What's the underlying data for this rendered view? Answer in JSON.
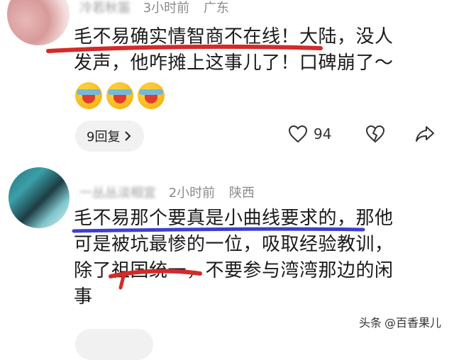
{
  "comments": [
    {
      "nickname": "冷若秋笛",
      "time": "3小时前",
      "location": "广东",
      "lines": [
        "毛不易确实情智商不在线！大陆，没人",
        "发声，他咋摊上这事儿了！口碑崩了～"
      ],
      "emoji_icons": [
        "laugh-cry-emoji",
        "laugh-cry-emoji",
        "laugh-cry-emoji"
      ],
      "reply_label": "9回复",
      "likes": "94"
    },
    {
      "nickname": "一丛丛淡相宜",
      "time": "2小时前",
      "location": "陕西",
      "lines": [
        "毛不易那个要真是小曲线要求的，那他",
        "可是被坑最惨的一位，吸取经验教训，",
        "除了祖国统一，不要参与湾湾那边的闲",
        "事"
      ]
    }
  ],
  "watermark": {
    "prefix": "头条",
    "handle": "@百香果儿"
  },
  "colors": {
    "highlight": "#d42a2a",
    "underline_blue": "#3b3fd0"
  }
}
